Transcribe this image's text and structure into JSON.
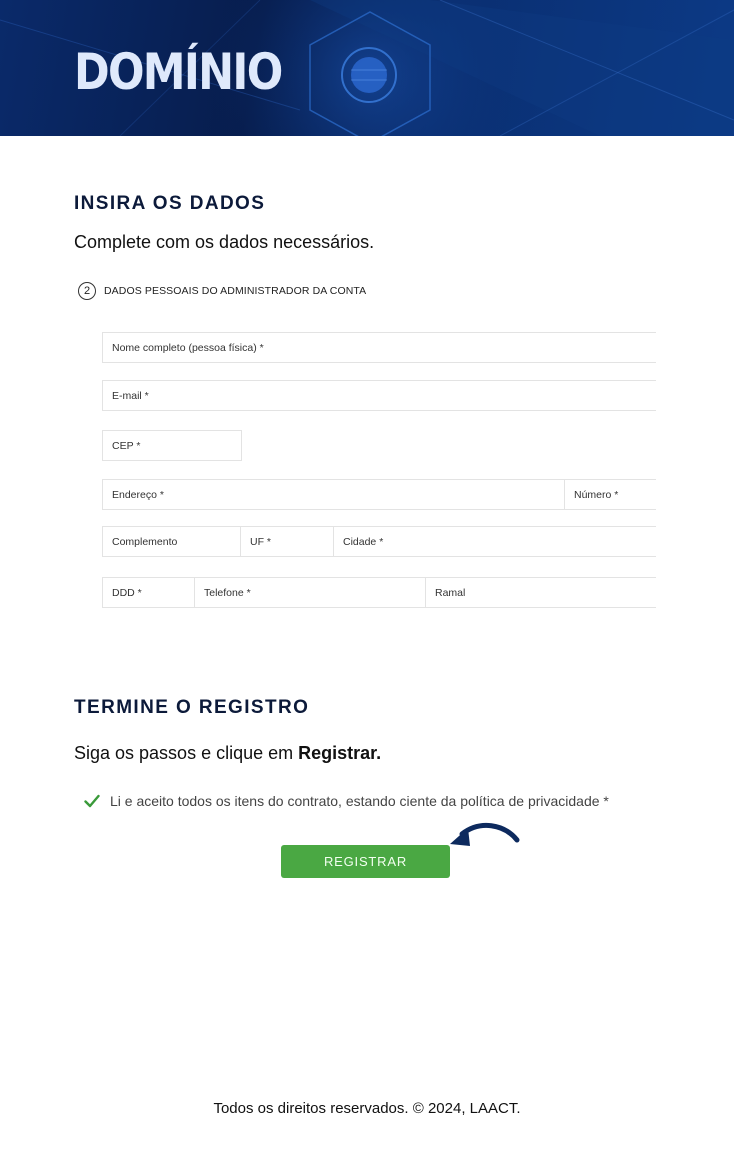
{
  "header": {
    "brand": "DOMÍNIO",
    "colors": {
      "banner_dark": "#071d4d",
      "banner_light": "#0c3a86",
      "brand_text": "#dfe9fb"
    }
  },
  "section_data": {
    "title": "INSIRA OS DADOS",
    "subtitle": "Complete com os dados necessários."
  },
  "step": {
    "number": "2",
    "label": "DADOS PESSOAIS DO ADMINISTRADOR DA CONTA"
  },
  "form": {
    "full_name": "Nome completo (pessoa física) *",
    "email": "E-mail *",
    "cep": "CEP *",
    "address": "Endereço *",
    "number": "Número *",
    "complement": "Complemento",
    "uf": "UF *",
    "city": "Cidade *",
    "ddd": "DDD *",
    "phone": "Telefone *",
    "extension": "Ramal"
  },
  "section_register": {
    "title": "TERMINE O REGISTRO",
    "text_prefix": "Siga os passos e clique em ",
    "text_bold": "Registrar."
  },
  "consent": {
    "text": "Li e aceito todos os itens do contrato, estando ciente da política de privacidade *",
    "checked": true,
    "icon": "check-icon",
    "color": "#3a9a3a"
  },
  "register_button": {
    "label": "REGISTRAR",
    "color": "#4aa843"
  },
  "arrow": {
    "icon": "curved-arrow-icon",
    "color": "#0d2a5e"
  },
  "footer": {
    "text": "Todos os direitos reservados. © 2024, LAACT."
  }
}
